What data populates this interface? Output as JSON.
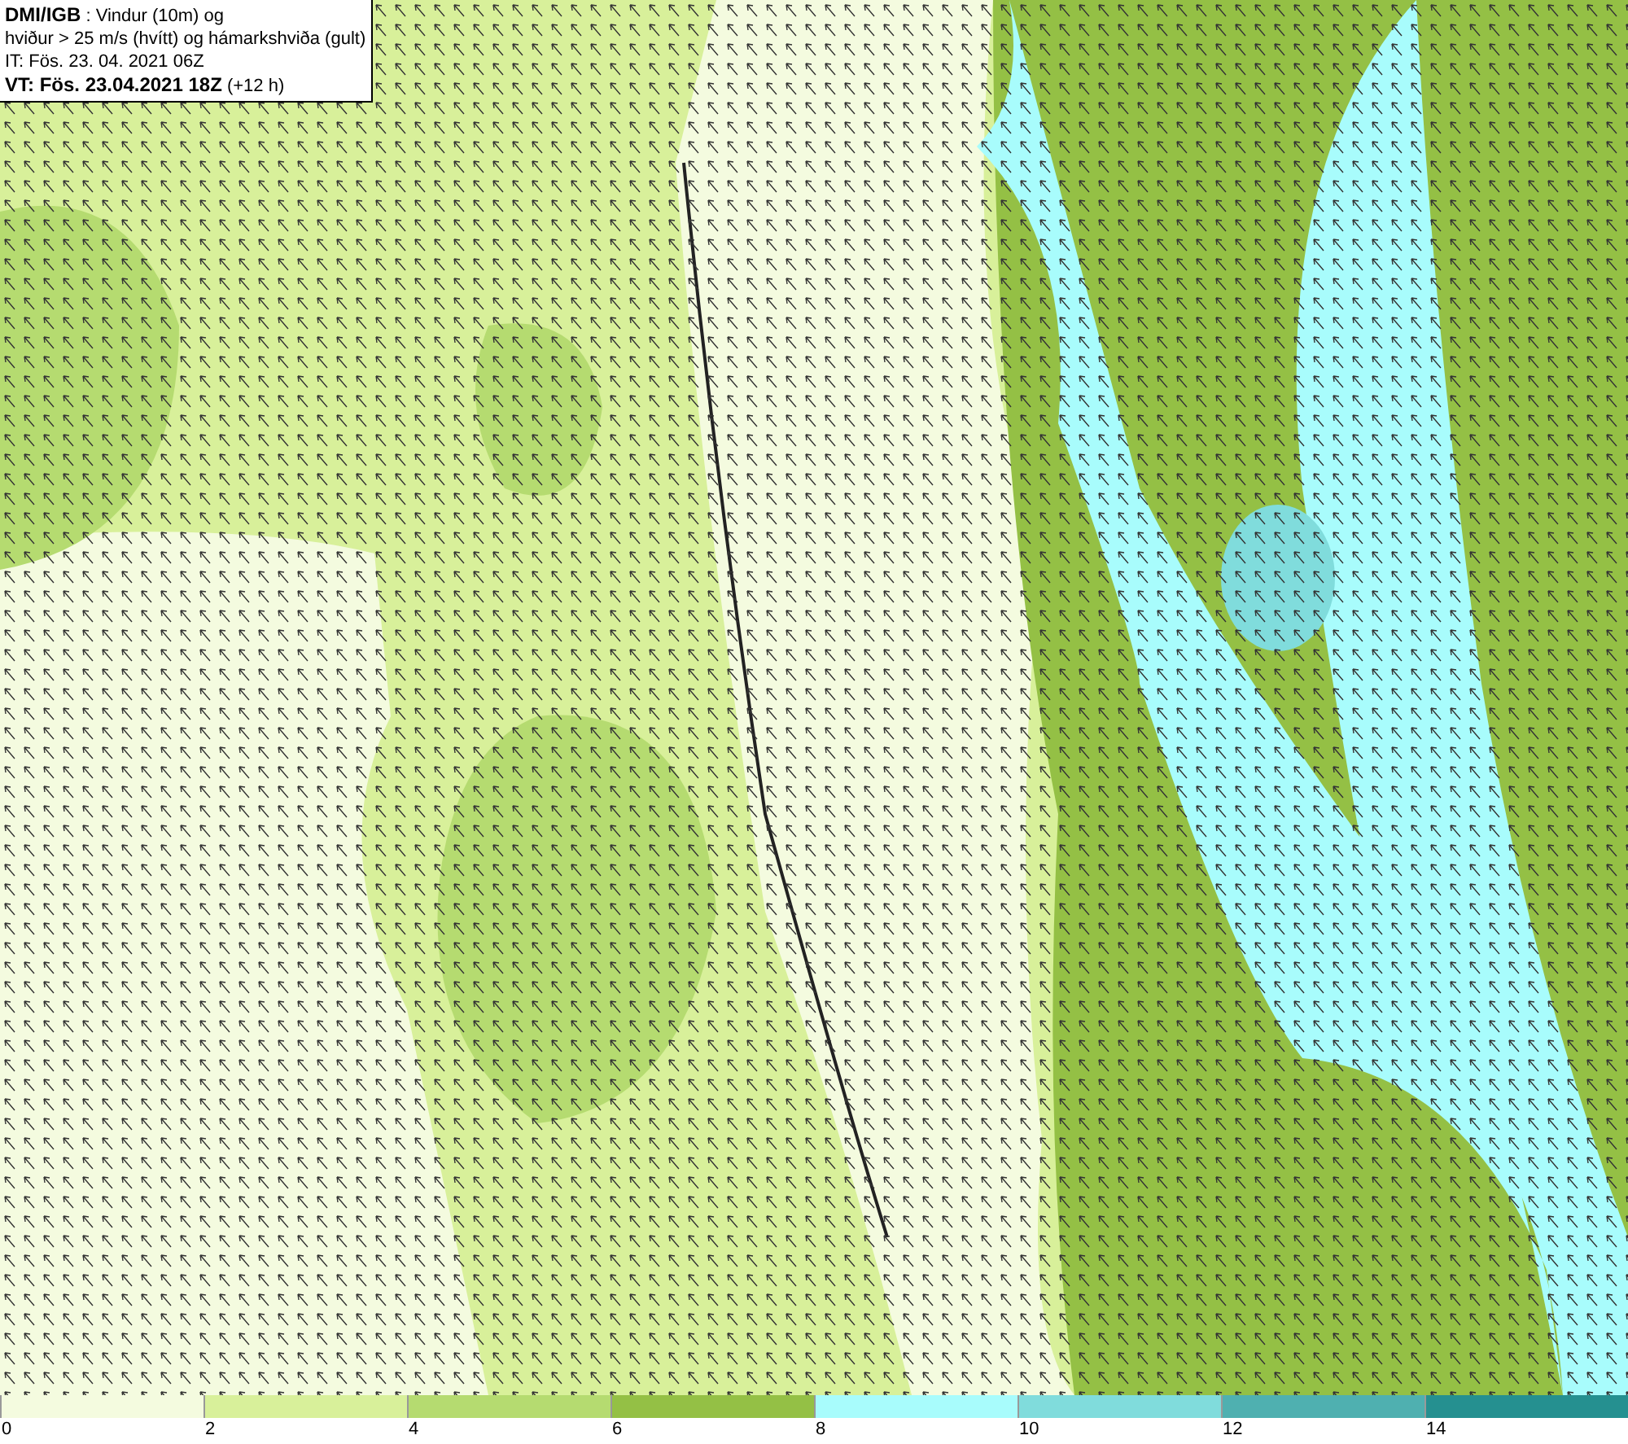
{
  "header": {
    "lines": [
      "**DMI/IGB** : Vindur (10m) og",
      "hviður > 25 m/s (hvítt) og hámarkshviða (gult)",
      "IT: Fös. 23. 04. 2021 06Z",
      "**VT: Fös. 23.04.2021 18Z** (+12 h)"
    ]
  },
  "legend": [
    {
      "label": "0",
      "color": "#f4fbdf"
    },
    {
      "label": "2",
      "color": "#d8f09a"
    },
    {
      "label": "4",
      "color": "#b5db70"
    },
    {
      "label": "6",
      "color": "#94c045"
    },
    {
      "label": "8",
      "color": "#a8fcfc"
    },
    {
      "label": "10",
      "color": "#80dcdc"
    },
    {
      "label": "12",
      "color": "#4fb0b0"
    },
    {
      "label": "14",
      "color": "#259090"
    }
  ]
}
